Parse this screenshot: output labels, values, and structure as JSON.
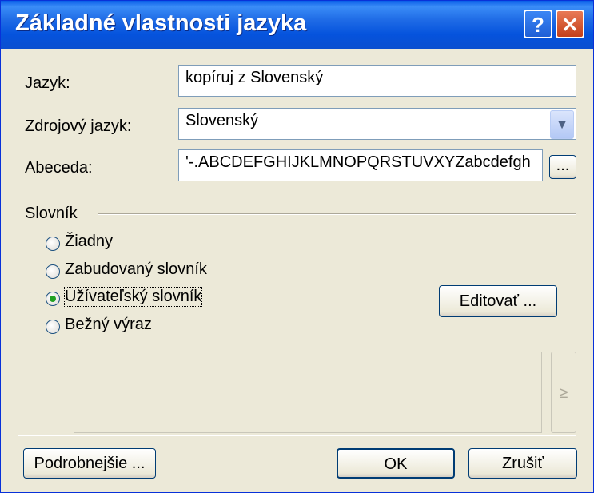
{
  "window": {
    "title": "Základné vlastnosti jazyka"
  },
  "titlebar": {
    "help_label": "?",
    "close_label": "✕"
  },
  "form": {
    "language_label": "Jazyk:",
    "language_value": "kopíruj z Slovenský",
    "source_label": "Zdrojový jazyk:",
    "source_value": "Slovenský",
    "alphabet_label": "Abeceda:",
    "alphabet_value": "'-.ABCDEFGHIJKLMNOPQRSTUVXYZabcdefgh",
    "alphabet_browse": "..."
  },
  "dictionary": {
    "section_label": "Slovník",
    "options": [
      {
        "label": "Žiadny",
        "checked": false
      },
      {
        "label": "Zabudovaný slovník",
        "checked": false
      },
      {
        "label": "Užívateľský slovník",
        "checked": true
      },
      {
        "label": "Bežný výraz",
        "checked": false
      }
    ],
    "edit_button": "Editovať ...",
    "arrow_button": "≥"
  },
  "footer": {
    "details_button": "Podrobnejšie ...",
    "ok_button": "OK",
    "cancel_button": "Zrušiť"
  },
  "colors": {
    "titlebar": "#0a5ee8",
    "face": "#ece9d8",
    "border": "#003c74"
  }
}
